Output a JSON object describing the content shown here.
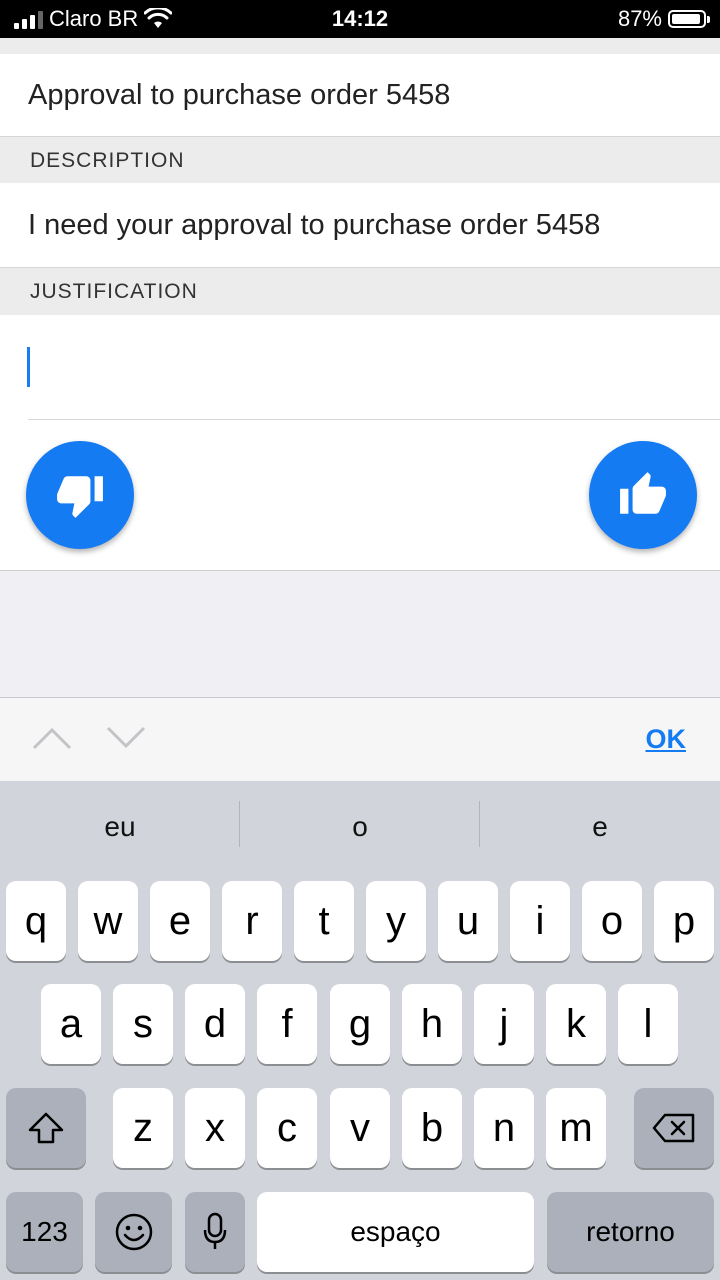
{
  "status_bar": {
    "carrier": "Claro BR",
    "time": "14:12",
    "battery": "87%"
  },
  "form": {
    "title_value": "Approval to purchase order 5458",
    "description_label": "DESCRIPTION",
    "description_value": "I need your approval to purchase order 5458",
    "justification_label": "JUSTIFICATION",
    "justification_value": ""
  },
  "actions": {
    "reject_icon": "thumbs-down-icon",
    "approve_icon": "thumbs-up-icon",
    "color": "#147bf3"
  },
  "accessory": {
    "ok_label": "OK"
  },
  "keyboard": {
    "suggestions": [
      "eu",
      "o",
      "e"
    ],
    "row1": [
      "q",
      "w",
      "e",
      "r",
      "t",
      "y",
      "u",
      "i",
      "o",
      "p"
    ],
    "row2": [
      "a",
      "s",
      "d",
      "f",
      "g",
      "h",
      "j",
      "k",
      "l"
    ],
    "row3": [
      "z",
      "x",
      "c",
      "v",
      "b",
      "n",
      "m"
    ],
    "numbers_label": "123",
    "space_label": "espaço",
    "return_label": "retorno"
  }
}
